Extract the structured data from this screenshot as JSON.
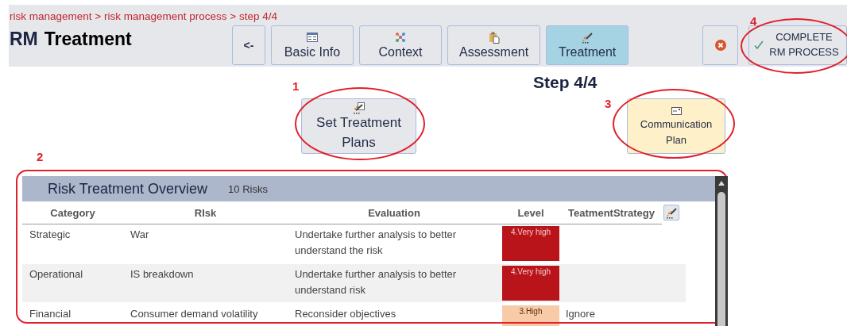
{
  "breadcrumb": "risk management > risk management process > step 4/4",
  "title": {
    "prefix": "RM",
    "text": "Treatment"
  },
  "back_button": "<-",
  "tabs": [
    {
      "label": "Basic Info",
      "selected": false
    },
    {
      "label": "Context",
      "selected": false
    },
    {
      "label": "Assessment",
      "selected": false
    },
    {
      "label": "Treatment",
      "selected": true
    }
  ],
  "complete_button": {
    "label": "COMPLETE RM PROCESS",
    "annotation": "4"
  },
  "step": "Step 4/4",
  "actions": [
    {
      "label": "Set Treatment Plans",
      "kind": "primary",
      "annotation": "1"
    },
    {
      "label": "Communication Plan",
      "kind": "secondary",
      "annotation": "3"
    }
  ],
  "overview": {
    "title": "Risk Treatment Overview",
    "count": "10 Risks",
    "annotation": "2",
    "columns": [
      "Category",
      "RIsk",
      "Evaluation",
      "Level",
      "TeatmentStrategy"
    ],
    "rows": [
      {
        "category": "Strategic",
        "risk": "War",
        "evaluation": "Undertake further analysis to better understand the risk",
        "level": "4.Very high",
        "color": "#b8141a",
        "strategy": ""
      },
      {
        "category": "Operational",
        "risk": "IS breakdown",
        "evaluation": "Undertake further analysis to better understand risk",
        "level": "4.Very high",
        "color": "#b8141a",
        "strategy": ""
      },
      {
        "category": "Financial",
        "risk": "Consumer demand volatility",
        "evaluation": "Reconsider objectives",
        "level": "3.High",
        "color": "#f8cba8",
        "strategy": "Ignore"
      }
    ]
  }
}
